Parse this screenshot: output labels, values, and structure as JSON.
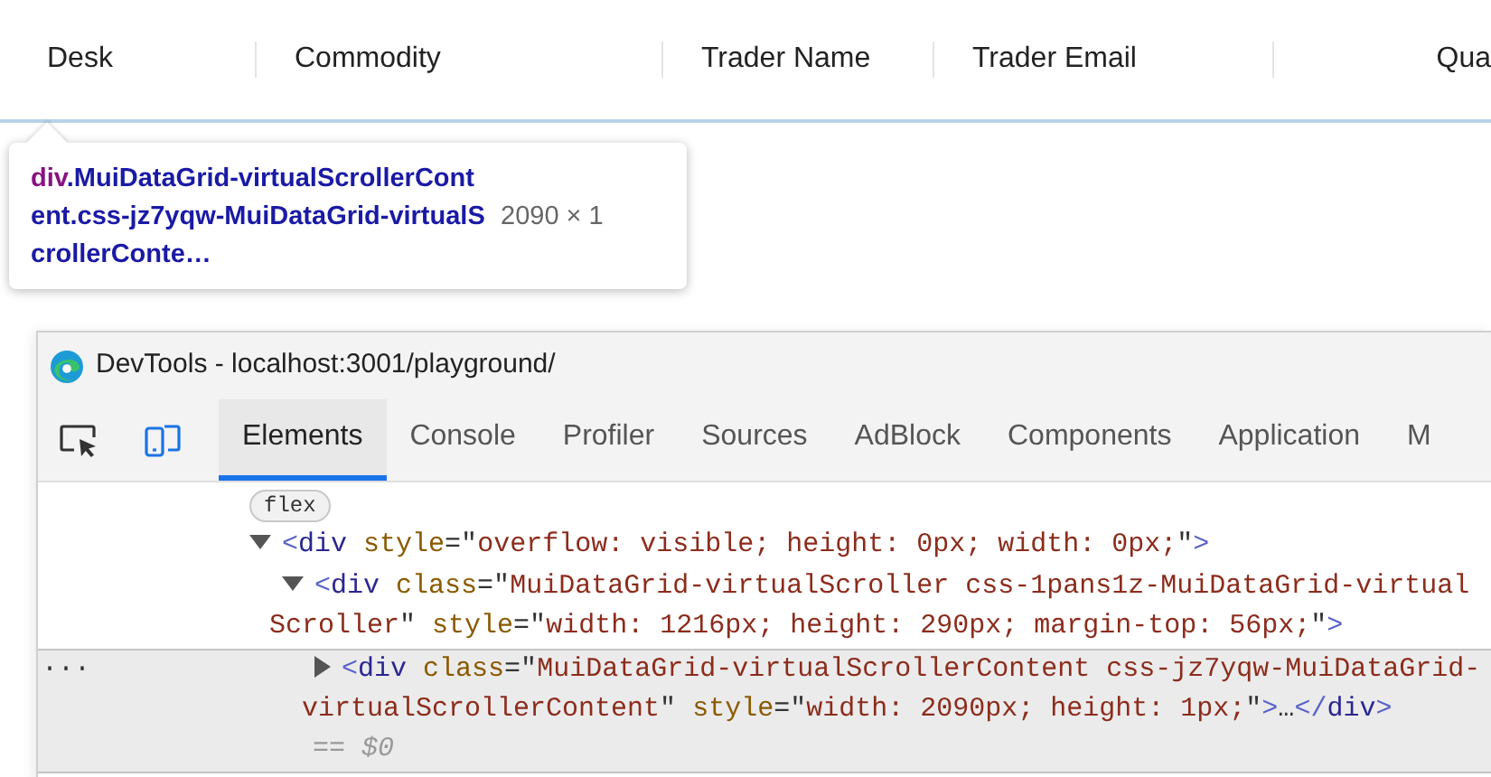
{
  "grid_header": {
    "columns": [
      {
        "label": "Desk"
      },
      {
        "label": "Commodity"
      },
      {
        "label": "Trader Name"
      },
      {
        "label": "Trader Email"
      },
      {
        "label": "Qua"
      }
    ]
  },
  "tooltip": {
    "tag": "div",
    "selector": ".MuiDataGrid-virtualScrollerContent.css-jz7yqw-MuiDataGrid-virtualScrollerConte…",
    "size": "2090 × 1"
  },
  "devtools": {
    "title": "DevTools - localhost:3001/playground/",
    "tabs": [
      {
        "label": "Elements",
        "selected": true
      },
      {
        "label": "Console",
        "selected": false
      },
      {
        "label": "Profiler",
        "selected": false
      },
      {
        "label": "Sources",
        "selected": false
      },
      {
        "label": "AdBlock",
        "selected": false
      },
      {
        "label": "Components",
        "selected": false
      },
      {
        "label": "Application",
        "selected": false
      },
      {
        "label": "M",
        "selected": false
      }
    ],
    "flex_badge": "flex",
    "nodes": [
      {
        "expanded": true,
        "selected": false,
        "lines": [
          [
            {
              "kind": "punct",
              "text": "<"
            },
            {
              "kind": "tag",
              "text": "div"
            },
            {
              "kind": "attr",
              "text": " style"
            },
            {
              "kind": "eq",
              "text": "=\""
            },
            {
              "kind": "value",
              "text": "overflow: visible; height: 0px; width: 0px;"
            },
            {
              "kind": "eq",
              "text": "\""
            },
            {
              "kind": "punct",
              "text": ">"
            }
          ]
        ],
        "children": [
          {
            "expanded": true,
            "selected": false,
            "lines": [
              [
                {
                  "kind": "punct",
                  "text": "<"
                },
                {
                  "kind": "tag",
                  "text": "div"
                },
                {
                  "kind": "attr",
                  "text": " class"
                },
                {
                  "kind": "eq",
                  "text": "=\""
                },
                {
                  "kind": "value",
                  "text": "MuiDataGrid-virtualScroller css-1pans1z-MuiDataGrid-virtual"
                }
              ],
              [
                {
                  "kind": "value",
                  "text": "Scroller"
                },
                {
                  "kind": "eq",
                  "text": "\""
                },
                {
                  "kind": "attr",
                  "text": " style"
                },
                {
                  "kind": "eq",
                  "text": "=\""
                },
                {
                  "kind": "value",
                  "text": "width: 1216px; height: 290px; margin-top: 56px;"
                },
                {
                  "kind": "eq",
                  "text": "\""
                },
                {
                  "kind": "punct",
                  "text": ">"
                }
              ]
            ],
            "children": [
              {
                "expanded": false,
                "selected": true,
                "gutter": "···",
                "note": "== $0",
                "lines": [
                  [
                    {
                      "kind": "punct",
                      "text": "<"
                    },
                    {
                      "kind": "tag",
                      "text": "div"
                    },
                    {
                      "kind": "attr",
                      "text": " class"
                    },
                    {
                      "kind": "eq",
                      "text": "=\""
                    },
                    {
                      "kind": "value",
                      "text": "MuiDataGrid-virtualScrollerContent css-jz7yqw-MuiDataGrid-"
                    }
                  ],
                  [
                    {
                      "kind": "value",
                      "text": "virtualScrollerContent"
                    },
                    {
                      "kind": "eq",
                      "text": "\""
                    },
                    {
                      "kind": "attr",
                      "text": " style"
                    },
                    {
                      "kind": "eq",
                      "text": "=\""
                    },
                    {
                      "kind": "value",
                      "text": "width: 2090px; height: 1px;"
                    },
                    {
                      "kind": "eq",
                      "text": "\""
                    },
                    {
                      "kind": "punct",
                      "text": ">"
                    },
                    {
                      "kind": "eq",
                      "text": "…"
                    },
                    {
                      "kind": "punct",
                      "text": "</"
                    },
                    {
                      "kind": "tag",
                      "text": "div"
                    },
                    {
                      "kind": "punct",
                      "text": ">"
                    }
                  ]
                ]
              }
            ]
          }
        ]
      }
    ]
  }
}
